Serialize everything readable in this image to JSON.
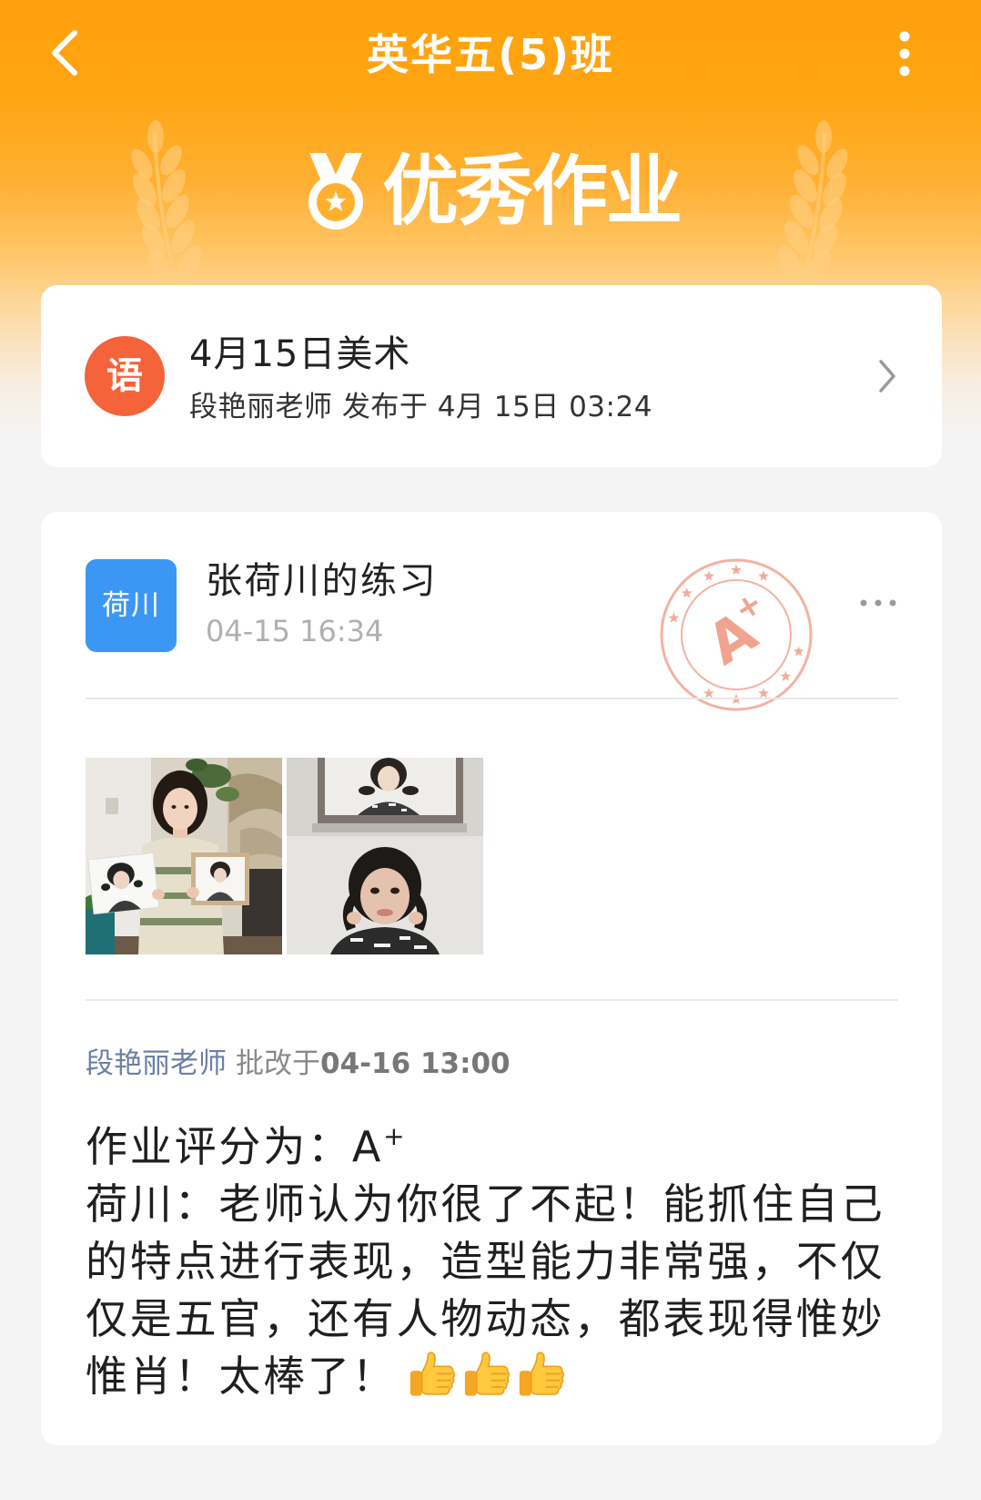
{
  "colors": {
    "header_orange": "#FFA10C",
    "page_bg": "#F4F4F4",
    "subject_badge": "#F4633A",
    "avatar_blue": "#3B97F3",
    "stamp": "#F2A890",
    "reviewer_name": "#6C7FA4"
  },
  "header": {
    "title": "英华五(5)班",
    "back_icon": "chevron-left-icon",
    "menu_icon": "more-vertical-icon"
  },
  "banner": {
    "icon": "medal-icon",
    "title": "优秀作业",
    "decoration_icon": "wheat-icon"
  },
  "assignment": {
    "subject_badge": "语",
    "title": "4月15日美术",
    "meta": "段艳丽老师 发布于 4月 15日 03:24",
    "arrow_icon": "chevron-right-icon"
  },
  "submission": {
    "avatar_text": "荷川",
    "title": "张荷川的练习",
    "time": "04-15 16:34",
    "stamp": {
      "grade": "A",
      "sup": "+"
    },
    "more_icon": "more-horizontal-icon"
  },
  "review": {
    "teacher": "段艳丽老师",
    "action": "批改于",
    "time": "04-16 13:00",
    "grade_label": "作业评分为：",
    "grade": "A",
    "grade_sup": "+",
    "comment_lines": [
      "荷川：老师认为你很了不起！能抓住自己",
      "的特点进行表现，造型能力非常强，不仅",
      "仅是五官，还有人物动态，都表现得惟妙",
      "惟肖！太棒了！"
    ],
    "emoji_icons": [
      "thumbs-up-icon",
      "thumbs-up-icon",
      "thumbs-up-icon"
    ]
  }
}
